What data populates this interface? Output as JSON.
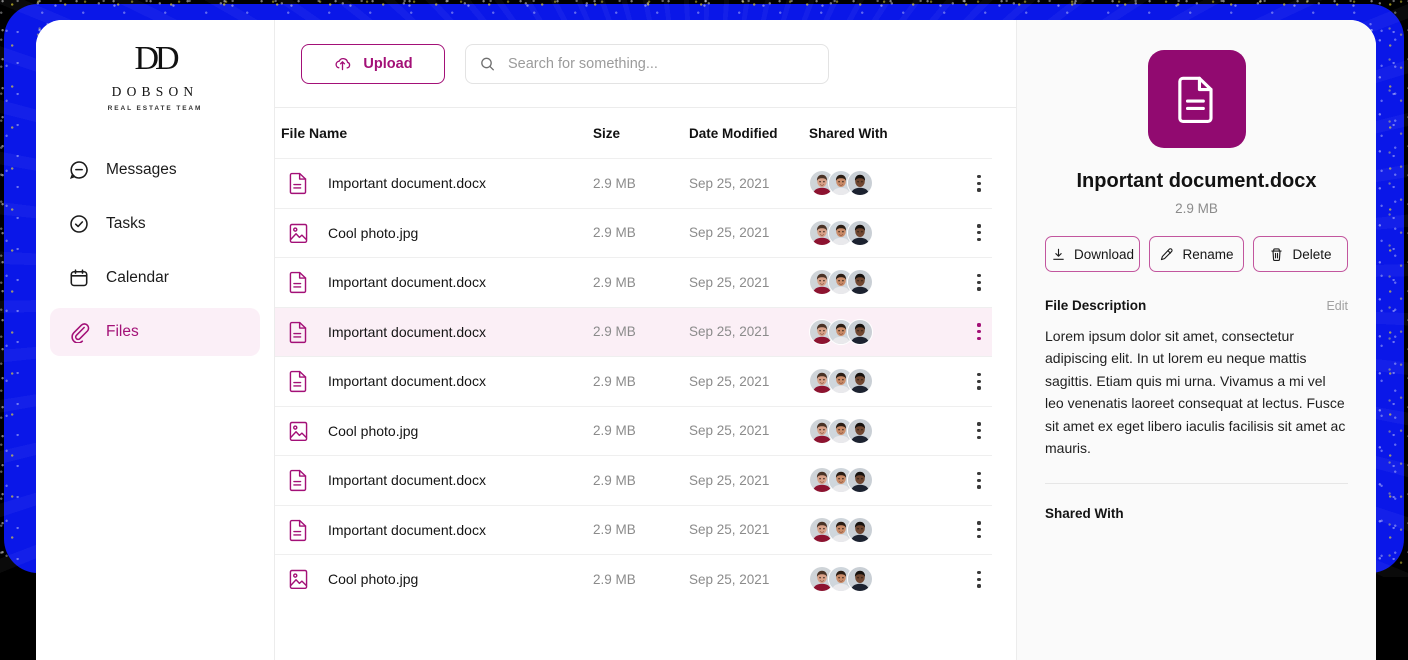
{
  "brand": {
    "mark": "DD",
    "name": "DOBSON",
    "tagline": "REAL ESTATE TEAM"
  },
  "sidebar": {
    "items": [
      {
        "label": "Messages",
        "icon": "message-icon",
        "active": false
      },
      {
        "label": "Tasks",
        "icon": "check-circle-icon",
        "active": false
      },
      {
        "label": "Calendar",
        "icon": "calendar-icon",
        "active": false
      },
      {
        "label": "Files",
        "icon": "paperclip-icon",
        "active": true
      }
    ]
  },
  "toolbar": {
    "upload_label": "Upload",
    "upload_icon": "cloud-upload-icon",
    "search_placeholder": "Search for something...",
    "search_value": "",
    "search_icon": "search-icon"
  },
  "table": {
    "columns": [
      "File Name",
      "Size",
      "Date Modified",
      "Shared With"
    ],
    "rows": [
      {
        "name": "Important document.docx",
        "type": "doc",
        "size": "2.9 MB",
        "date": "Sep 25, 2021",
        "selected": false
      },
      {
        "name": "Cool photo.jpg",
        "type": "image",
        "size": "2.9 MB",
        "date": "Sep 25, 2021",
        "selected": false
      },
      {
        "name": "Important document.docx",
        "type": "doc",
        "size": "2.9 MB",
        "date": "Sep 25, 2021",
        "selected": false
      },
      {
        "name": "Important document.docx",
        "type": "doc",
        "size": "2.9 MB",
        "date": "Sep 25, 2021",
        "selected": true
      },
      {
        "name": "Important document.docx",
        "type": "doc",
        "size": "2.9 MB",
        "date": "Sep 25, 2021",
        "selected": false
      },
      {
        "name": "Cool photo.jpg",
        "type": "image",
        "size": "2.9 MB",
        "date": "Sep 25, 2021",
        "selected": false
      },
      {
        "name": "Important document.docx",
        "type": "doc",
        "size": "2.9 MB",
        "date": "Sep 25, 2021",
        "selected": false
      },
      {
        "name": "Important document.docx",
        "type": "doc",
        "size": "2.9 MB",
        "date": "Sep 25, 2021",
        "selected": false
      },
      {
        "name": "Cool photo.jpg",
        "type": "image",
        "size": "2.9 MB",
        "date": "Sep 25, 2021",
        "selected": false
      }
    ]
  },
  "detail": {
    "file_icon": "document-icon",
    "title": "Inportant document.docx",
    "size": "2.9 MB",
    "actions": [
      {
        "label": "Download",
        "icon": "download-icon"
      },
      {
        "label": "Rename",
        "icon": "pencil-icon"
      },
      {
        "label": "Delete",
        "icon": "trash-icon"
      }
    ],
    "description_title": "File Description",
    "description_edit": "Edit",
    "description": "Lorem ipsum dolor sit amet, consectetur adipiscing elit. In ut lorem eu neque mattis sagittis. Etiam quis mi urna. Vivamus a mi vel leo venenatis laoreet consequat at lectus. Fusce sit amet ex eget libero iaculis facilisis sit amet ac mauris.",
    "shared_title": "Shared With"
  },
  "colors": {
    "accent": "#a31077",
    "tile": "#910a70",
    "selected_row": "#fbeff6",
    "frame": "#0a17e8"
  }
}
